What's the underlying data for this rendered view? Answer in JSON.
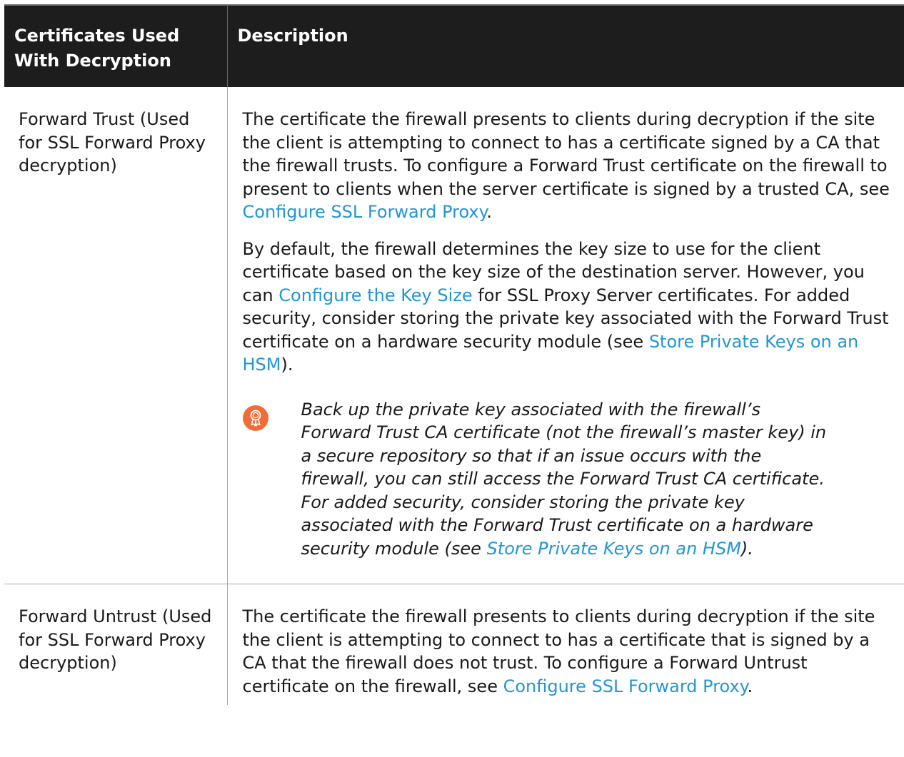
{
  "header": {
    "col1": "Certificates Used With Decryption",
    "col2": "Description"
  },
  "rows": [
    {
      "name": "Forward Trust (Used for SSL Forward Proxy decryption)",
      "p1": {
        "text1": "The certificate the firewall presents to clients during decryption if the site the client is attempting to connect to has a certificate signed by a CA that the firewall trusts. To configure a Forward Trust certificate on the firewall to present to clients when the server certificate is signed by a trusted CA, see ",
        "link1": "Configure SSL Forward Proxy",
        "text2": "."
      },
      "p2": {
        "text1": "By default, the firewall determines the key size to use for the client certificate based on the key size of the destination server. However, you can ",
        "link1": "Configure the Key Size",
        "text2": " for SSL Proxy Server certificates. For added security, consider storing the private key associated with the Forward Trust certificate on a hardware security module (see ",
        "link2": "Store Private Keys on an HSM",
        "text3": ")."
      },
      "note": {
        "icon": "best-practice-ribbon-icon",
        "icon_color": "#f26b3a",
        "text1": "Back up the private key associated with the firewall’s Forward Trust CA certificate (not the firewall’s master key) in a secure repository so that if an issue occurs with the firewall, you can still access the Forward Trust CA certificate. For added security, consider storing the private key associated with the Forward Trust certificate on a hardware security module (see ",
        "link1": "Store Private Keys on an HSM",
        "text2": ")."
      }
    },
    {
      "name": "Forward Untrust (Used for SSL Forward Proxy decryption)",
      "p1": {
        "text1": "The certificate the firewall presents to clients during decryption if the site the client is attempting to connect to has a certificate that is signed by a CA that the firewall does not trust. To configure a Forward Untrust certificate on the firewall, see ",
        "link1": "Configure SSL Forward Proxy",
        "text2": "."
      }
    }
  ],
  "colors": {
    "header_bg": "#1d1d1d",
    "header_text": "#ffffff",
    "link": "#2196d5",
    "text": "#1a1a1a",
    "border": "#a8a8a8"
  }
}
